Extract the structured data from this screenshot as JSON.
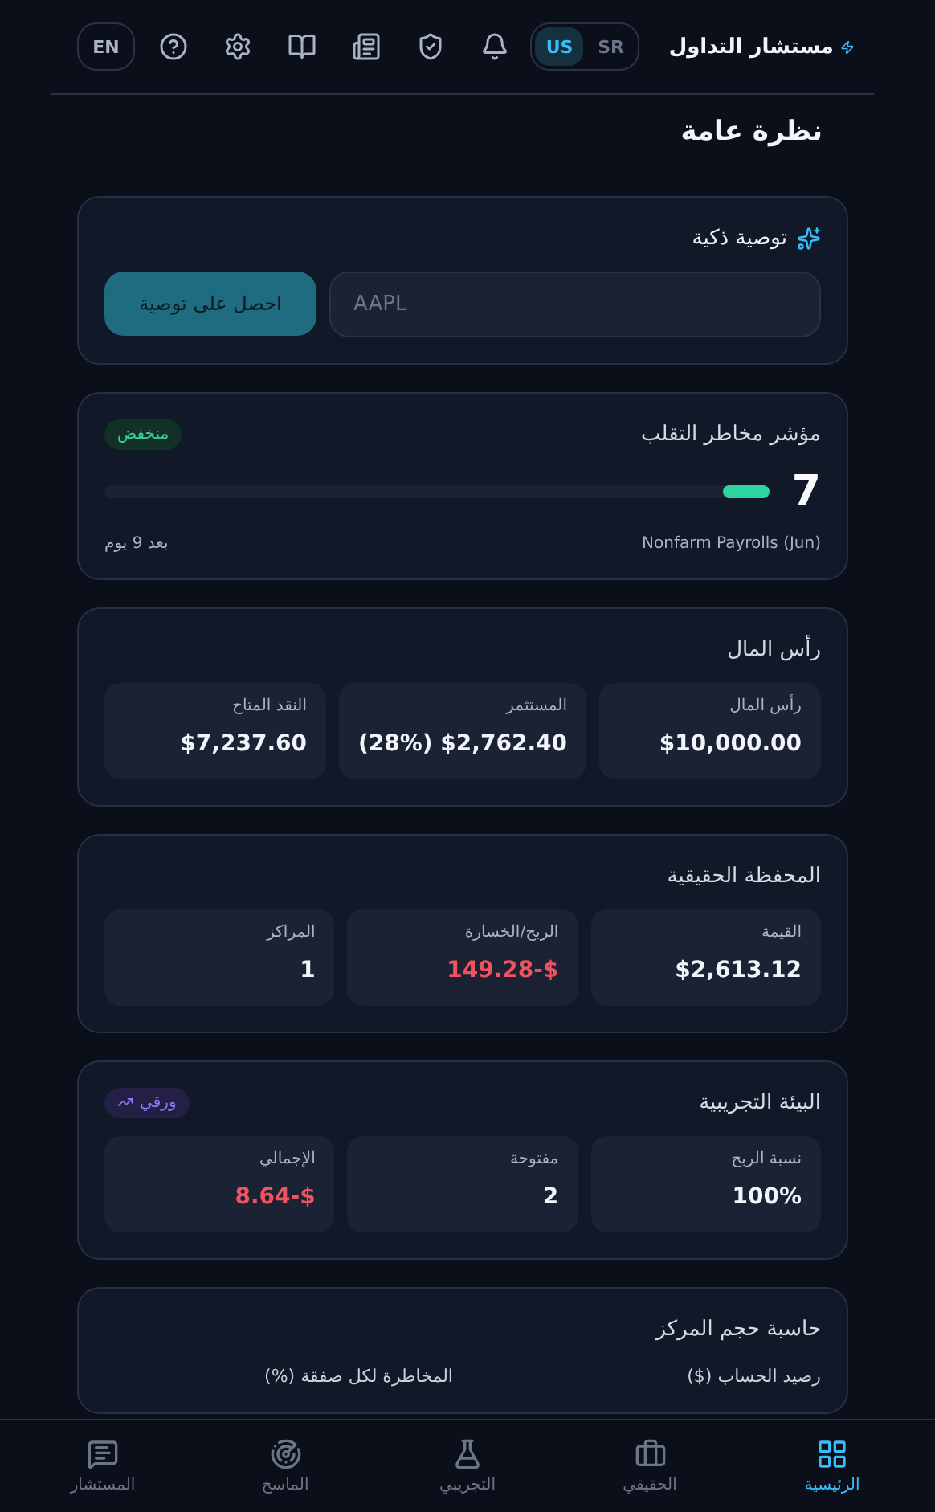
{
  "header": {
    "brand": "مستشار التداول",
    "market_toggle": [
      {
        "label": "SR",
        "selected": false
      },
      {
        "label": "US",
        "selected": true
      }
    ],
    "language": "EN"
  },
  "page_title": "نظرة عامة",
  "smart_recommendation": {
    "title": "توصية ذكية",
    "input": {
      "placeholder": "AAPL"
    },
    "button": "احصل على توصية"
  },
  "volatility": {
    "title": "مؤشر مخاطر التقلب",
    "badge": "منخفض",
    "value": "7",
    "level": 0.07,
    "event": "Nonfarm Payrolls (Jun)",
    "countdown": "بعد 9 يوم"
  },
  "sections": [
    {
      "title": "رأس المال",
      "stats": [
        {
          "label": "رأس المال",
          "value": "$10,000.00",
          "negative": false
        },
        {
          "label": "المستثمر",
          "value": "(28%) $2,762.40",
          "negative": false
        },
        {
          "label": "النقد المتاح",
          "value": "$7,237.60",
          "negative": false
        }
      ]
    },
    {
      "title": "المحفظة الحقيقية",
      "stats": [
        {
          "label": "القيمة",
          "value": "$2,613.12",
          "negative": false
        },
        {
          "label": "الربح/الخسارة",
          "value": "149.28-$",
          "negative": true
        },
        {
          "label": "المراكز",
          "value": "1",
          "negative": false
        }
      ]
    },
    {
      "title": "البيئة التجريبية",
      "badge": "ورقي",
      "stats": [
        {
          "label": "نسبة الربح",
          "value": "100%",
          "negative": false
        },
        {
          "label": "مفتوحة",
          "value": "2",
          "negative": false
        },
        {
          "label": "الإجمالي",
          "value": "8.64-$",
          "negative": true
        }
      ]
    }
  ],
  "position_calculator": {
    "title": "حاسبة حجم المركز",
    "fields": [
      "رصيد الحساب ($)",
      "المخاطرة لكل صفقة (%)"
    ]
  },
  "bottom_nav": [
    {
      "label": "الرئيسية",
      "selected": true
    },
    {
      "label": "الحقيقي",
      "selected": false
    },
    {
      "label": "التجريبي",
      "selected": false
    },
    {
      "label": "الماسح",
      "selected": false
    },
    {
      "label": "المستشار",
      "selected": false
    }
  ]
}
